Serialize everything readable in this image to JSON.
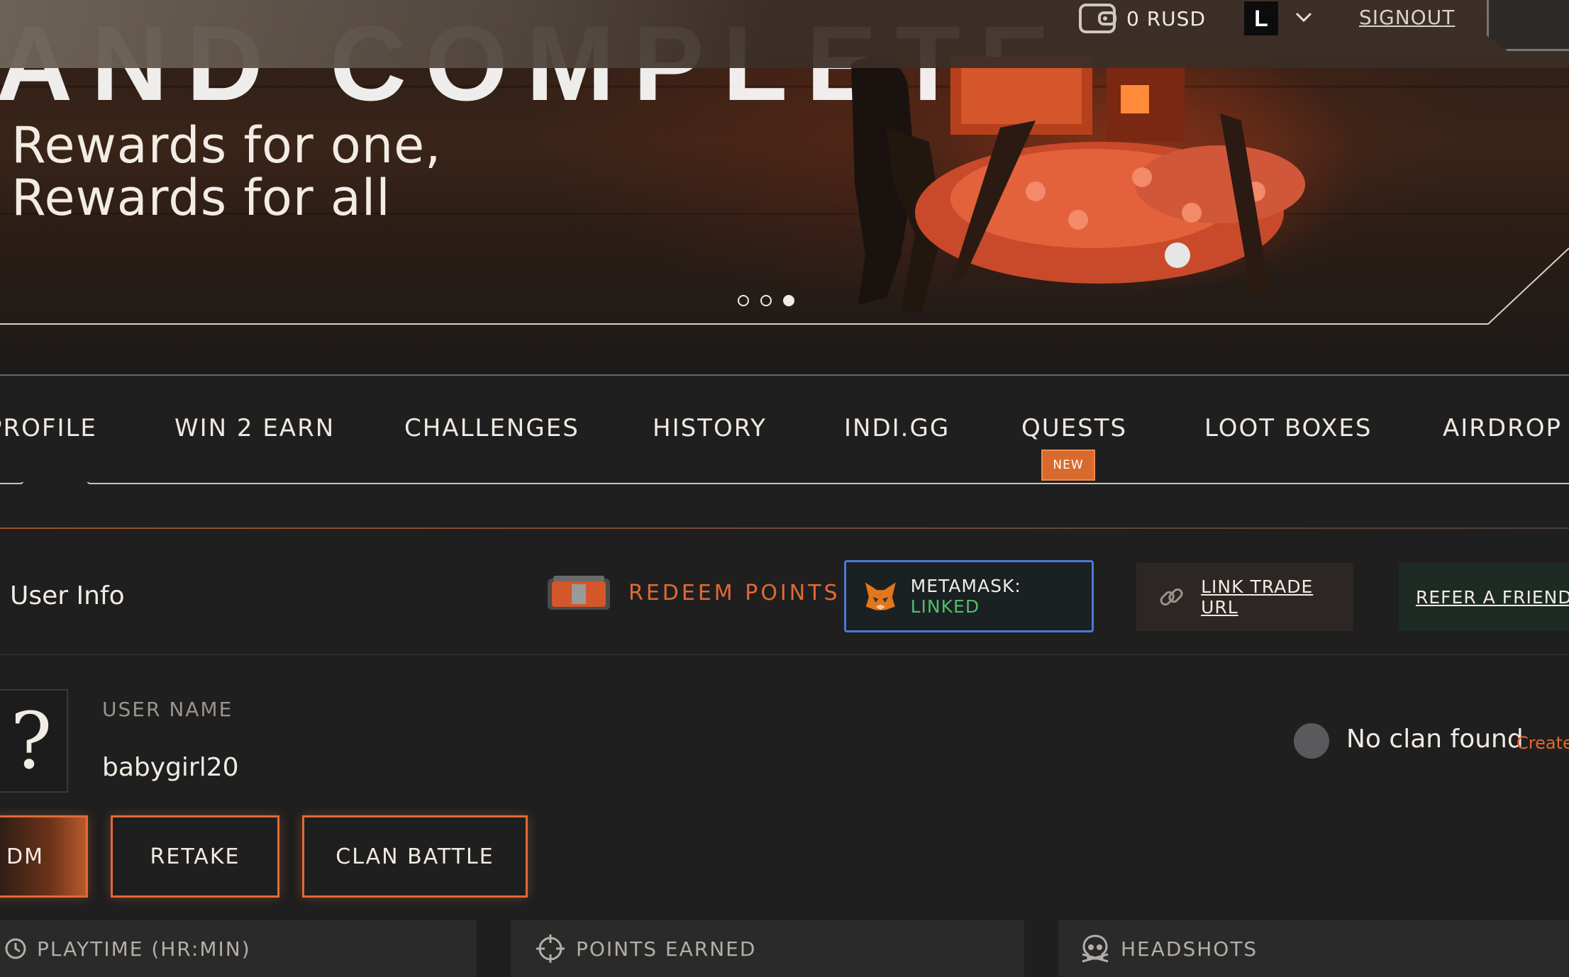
{
  "topbar": {
    "balance": "0 RUSD",
    "user_logo_text": "L",
    "signout_label": "SIGNOUT"
  },
  "hero": {
    "headline": "AND COMPLETE",
    "subline_1": "Rewards for one,",
    "subline_2": "Rewards for all",
    "carousel_active_index": 3,
    "carousel_count": 3
  },
  "tabs": {
    "items": [
      {
        "label": "PROFILE"
      },
      {
        "label": "WIN 2 EARN"
      },
      {
        "label": "CHALLENGES"
      },
      {
        "label": "HISTORY"
      },
      {
        "label": "INDI.GG"
      },
      {
        "label": "QUESTS"
      },
      {
        "label": "LOOT BOXES"
      },
      {
        "label": "AIRDROP"
      }
    ],
    "quests_badge": "NEW",
    "active": "PROFILE"
  },
  "user_info": {
    "title": "User Info",
    "redeem_label": "REDEEM POINTS",
    "metamask_label": "METAMASK: ",
    "metamask_status": "LINKED",
    "trade_url_label": "LINK TRADE URL",
    "refer_label": "REFER A FRIEND"
  },
  "user": {
    "avatar_placeholder": "?",
    "username_label": "USER NAME",
    "username": "babygirl20",
    "clan_text": "No clan found",
    "clan_create": "Create"
  },
  "modes": {
    "items": [
      "DM",
      "RETAKE",
      "CLAN BATTLE"
    ],
    "active": "DM"
  },
  "stats": {
    "playtime_label": "PLAYTIME (HR:MIN)",
    "points_label": "POINTS EARNED",
    "headshots_label": "HEADSHOTS"
  },
  "colors": {
    "accent": "#e06a34",
    "linked": "#4fbf6a",
    "metamask_border": "#4d79d4",
    "background": "#1f1f1f"
  }
}
